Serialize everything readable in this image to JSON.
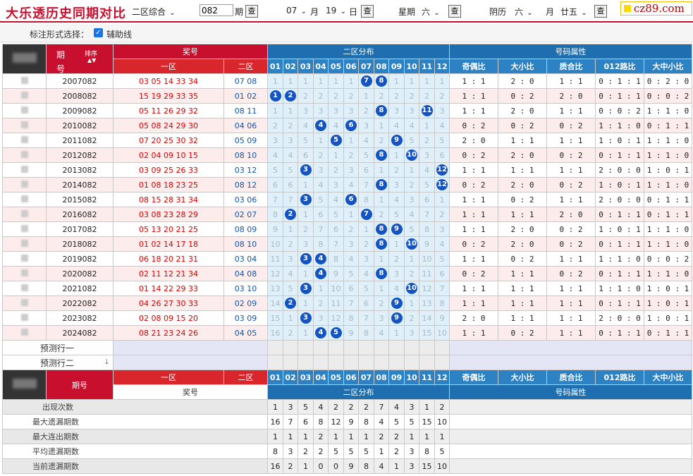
{
  "header": {
    "title": "大乐透历史同期对比",
    "zone_select": "二区综合",
    "issue_value": "082",
    "issue_label": "期",
    "query": "查",
    "month_value": "07",
    "month_label": "月",
    "day_value": "19",
    "day_label": "日",
    "week_label": "星期",
    "week_value": "六",
    "lunar_label": "阴历",
    "lunar_month": "六",
    "lunar_month_label": "月",
    "lunar_day": "廿五",
    "site": "cz89.com"
  },
  "options": {
    "label": "标注形式选择：",
    "checkbox_label": "辅助线",
    "checked": true
  },
  "table_header": {
    "period": "期号",
    "period_top": "期",
    "period_bottom": "号",
    "sort": "排序",
    "prize": "奖号",
    "zone1": "一区",
    "zone2": "二区",
    "dist": "二区分布",
    "attrs": "号码属性",
    "cols": [
      "01",
      "02",
      "03",
      "04",
      "05",
      "06",
      "07",
      "08",
      "09",
      "10",
      "11",
      "12"
    ],
    "attr_cols": [
      "奇偶比",
      "大小比",
      "质合比",
      "012路比",
      "大中小比"
    ]
  },
  "rows": [
    {
      "period": "2007082",
      "z1": "03 05 14 33 34",
      "z2": "07 08",
      "dist": [
        "1",
        "1",
        "1",
        "1",
        "1",
        "1",
        "7",
        "8",
        "1",
        "1",
        "1",
        "1"
      ],
      "hits": [
        7,
        8
      ],
      "attrs": [
        "1 : 1",
        "2 : 0",
        "1 : 1",
        "0 : 1 : 1",
        "0 : 2 : 0"
      ]
    },
    {
      "period": "2008082",
      "z1": "15 19 29 33 35",
      "z2": "01 02",
      "dist": [
        "1",
        "2",
        "2",
        "2",
        "2",
        "2",
        "1",
        "2",
        "2",
        "2",
        "2",
        "2"
      ],
      "hits": [
        1,
        2
      ],
      "attrs": [
        "1 : 1",
        "0 : 2",
        "2 : 0",
        "0 : 1 : 1",
        "0 : 0 : 2"
      ]
    },
    {
      "period": "2009082",
      "z1": "05 11 26 29 32",
      "z2": "08 11",
      "dist": [
        "1",
        "1",
        "3",
        "3",
        "3",
        "3",
        "2",
        "8",
        "3",
        "3",
        "11",
        "3"
      ],
      "hits": [
        8,
        11
      ],
      "attrs": [
        "1 : 1",
        "2 : 0",
        "1 : 1",
        "0 : 0 : 2",
        "1 : 1 : 0"
      ]
    },
    {
      "period": "2010082",
      "z1": "05 08 24 29 30",
      "z2": "04 06",
      "dist": [
        "2",
        "2",
        "4",
        "4",
        "4",
        "6",
        "3",
        "1",
        "4",
        "4",
        "1",
        "4"
      ],
      "hits": [
        4,
        6
      ],
      "attrs": [
        "0 : 2",
        "0 : 2",
        "0 : 2",
        "1 : 1 : 0",
        "0 : 1 : 1"
      ]
    },
    {
      "period": "2011082",
      "z1": "07 20 25 30 32",
      "z2": "05 09",
      "dist": [
        "3",
        "3",
        "5",
        "1",
        "5",
        "1",
        "4",
        "2",
        "9",
        "5",
        "2",
        "5"
      ],
      "hits": [
        5,
        9
      ],
      "attrs": [
        "2 : 0",
        "1 : 1",
        "1 : 1",
        "1 : 0 : 1",
        "1 : 1 : 0"
      ]
    },
    {
      "period": "2012082",
      "z1": "02 04 09 10 15",
      "z2": "08 10",
      "dist": [
        "4",
        "4",
        "6",
        "2",
        "1",
        "2",
        "5",
        "8",
        "1",
        "10",
        "3",
        "6"
      ],
      "hits": [
        8,
        10
      ],
      "attrs": [
        "0 : 2",
        "2 : 0",
        "0 : 2",
        "0 : 1 : 1",
        "1 : 1 : 0"
      ]
    },
    {
      "period": "2013082",
      "z1": "03 09 25 26 33",
      "z2": "03 12",
      "dist": [
        "5",
        "5",
        "3",
        "3",
        "2",
        "3",
        "6",
        "1",
        "2",
        "1",
        "4",
        "12"
      ],
      "hits": [
        3,
        12
      ],
      "attrs": [
        "1 : 1",
        "1 : 1",
        "1 : 1",
        "2 : 0 : 0",
        "1 : 0 : 1"
      ]
    },
    {
      "period": "2014082",
      "z1": "01 08 18 23 25",
      "z2": "08 12",
      "dist": [
        "6",
        "6",
        "1",
        "4",
        "3",
        "4",
        "7",
        "8",
        "3",
        "2",
        "5",
        "12"
      ],
      "hits": [
        8,
        12
      ],
      "attrs": [
        "0 : 2",
        "2 : 0",
        "0 : 2",
        "1 : 0 : 1",
        "1 : 1 : 0"
      ]
    },
    {
      "period": "2015082",
      "z1": "08 15 28 31 34",
      "z2": "03 06",
      "dist": [
        "7",
        "7",
        "3",
        "5",
        "4",
        "6",
        "8",
        "1",
        "4",
        "3",
        "6",
        "1"
      ],
      "hits": [
        3,
        6
      ],
      "attrs": [
        "1 : 1",
        "0 : 2",
        "1 : 1",
        "2 : 0 : 0",
        "0 : 1 : 1"
      ]
    },
    {
      "period": "2016082",
      "z1": "03 08 23 28 29",
      "z2": "02 07",
      "dist": [
        "8",
        "2",
        "1",
        "6",
        "5",
        "1",
        "7",
        "2",
        "5",
        "4",
        "7",
        "2"
      ],
      "hits": [
        2,
        7
      ],
      "attrs": [
        "1 : 1",
        "1 : 1",
        "2 : 0",
        "0 : 1 : 1",
        "0 : 1 : 1"
      ]
    },
    {
      "period": "2017082",
      "z1": "05 13 20 21 25",
      "z2": "08 09",
      "dist": [
        "9",
        "1",
        "2",
        "7",
        "6",
        "2",
        "1",
        "8",
        "9",
        "5",
        "8",
        "3"
      ],
      "hits": [
        8,
        9
      ],
      "attrs": [
        "1 : 1",
        "2 : 0",
        "0 : 2",
        "1 : 0 : 1",
        "1 : 1 : 0"
      ]
    },
    {
      "period": "2018082",
      "z1": "01 02 14 17 18",
      "z2": "08 10",
      "dist": [
        "10",
        "2",
        "3",
        "8",
        "7",
        "3",
        "2",
        "8",
        "1",
        "10",
        "9",
        "4"
      ],
      "hits": [
        8,
        10
      ],
      "attrs": [
        "0 : 2",
        "2 : 0",
        "0 : 2",
        "0 : 1 : 1",
        "1 : 1 : 0"
      ]
    },
    {
      "period": "2019082",
      "z1": "06 18 20 21 31",
      "z2": "03 04",
      "dist": [
        "11",
        "3",
        "3",
        "4",
        "8",
        "4",
        "3",
        "1",
        "2",
        "1",
        "10",
        "5"
      ],
      "hits": [
        3,
        4
      ],
      "attrs": [
        "1 : 1",
        "0 : 2",
        "1 : 1",
        "1 : 1 : 0",
        "0 : 0 : 2"
      ]
    },
    {
      "period": "2020082",
      "z1": "02 11 12 21 34",
      "z2": "04 08",
      "dist": [
        "12",
        "4",
        "1",
        "4",
        "9",
        "5",
        "4",
        "8",
        "3",
        "2",
        "11",
        "6"
      ],
      "hits": [
        4,
        8
      ],
      "attrs": [
        "0 : 2",
        "1 : 1",
        "0 : 2",
        "0 : 1 : 1",
        "1 : 1 : 0"
      ]
    },
    {
      "period": "2021082",
      "z1": "01 14 22 29 33",
      "z2": "03 10",
      "dist": [
        "13",
        "5",
        "3",
        "1",
        "10",
        "6",
        "5",
        "1",
        "4",
        "10",
        "12",
        "7"
      ],
      "hits": [
        3,
        10
      ],
      "attrs": [
        "1 : 1",
        "1 : 1",
        "1 : 1",
        "1 : 1 : 0",
        "1 : 0 : 1"
      ]
    },
    {
      "period": "2022082",
      "z1": "04 26 27 30 33",
      "z2": "02 09",
      "dist": [
        "14",
        "2",
        "1",
        "2",
        "11",
        "7",
        "6",
        "2",
        "9",
        "1",
        "13",
        "8"
      ],
      "hits": [
        2,
        9
      ],
      "attrs": [
        "1 : 1",
        "1 : 1",
        "1 : 1",
        "0 : 1 : 1",
        "1 : 0 : 1"
      ]
    },
    {
      "period": "2023082",
      "z1": "02 08 09 15 20",
      "z2": "03 09",
      "dist": [
        "15",
        "1",
        "3",
        "3",
        "12",
        "8",
        "7",
        "3",
        "9",
        "2",
        "14",
        "9"
      ],
      "hits": [
        3,
        9
      ],
      "attrs": [
        "2 : 0",
        "1 : 1",
        "1 : 1",
        "2 : 0 : 0",
        "1 : 0 : 1"
      ]
    },
    {
      "period": "2024082",
      "z1": "08 21 23 24 26",
      "z2": "04 05",
      "dist": [
        "16",
        "2",
        "1",
        "4",
        "5",
        "9",
        "8",
        "4",
        "1",
        "3",
        "15",
        "10"
      ],
      "hits": [
        4,
        5
      ],
      "attrs": [
        "1 : 1",
        "0 : 2",
        "1 : 1",
        "0 : 1 : 1",
        "0 : 1 : 1"
      ]
    }
  ],
  "predict": {
    "row1": "预测行一",
    "row2": "预测行二"
  },
  "stats": {
    "labels": [
      "出现次数",
      "最大遗漏期数",
      "最大连出期数",
      "平均遗漏期数",
      "当前遗漏期数"
    ],
    "values": [
      [
        "1",
        "3",
        "5",
        "4",
        "2",
        "2",
        "2",
        "7",
        "4",
        "3",
        "1",
        "2"
      ],
      [
        "16",
        "7",
        "6",
        "8",
        "12",
        "9",
        "8",
        "4",
        "5",
        "5",
        "15",
        "10"
      ],
      [
        "1",
        "1",
        "1",
        "2",
        "1",
        "1",
        "1",
        "2",
        "2",
        "1",
        "1",
        "1"
      ],
      [
        "8",
        "3",
        "2",
        "2",
        "5",
        "5",
        "5",
        "1",
        "2",
        "3",
        "8",
        "5"
      ],
      [
        "16",
        "2",
        "1",
        "0",
        "0",
        "9",
        "8",
        "4",
        "1",
        "3",
        "15",
        "10"
      ]
    ]
  }
}
